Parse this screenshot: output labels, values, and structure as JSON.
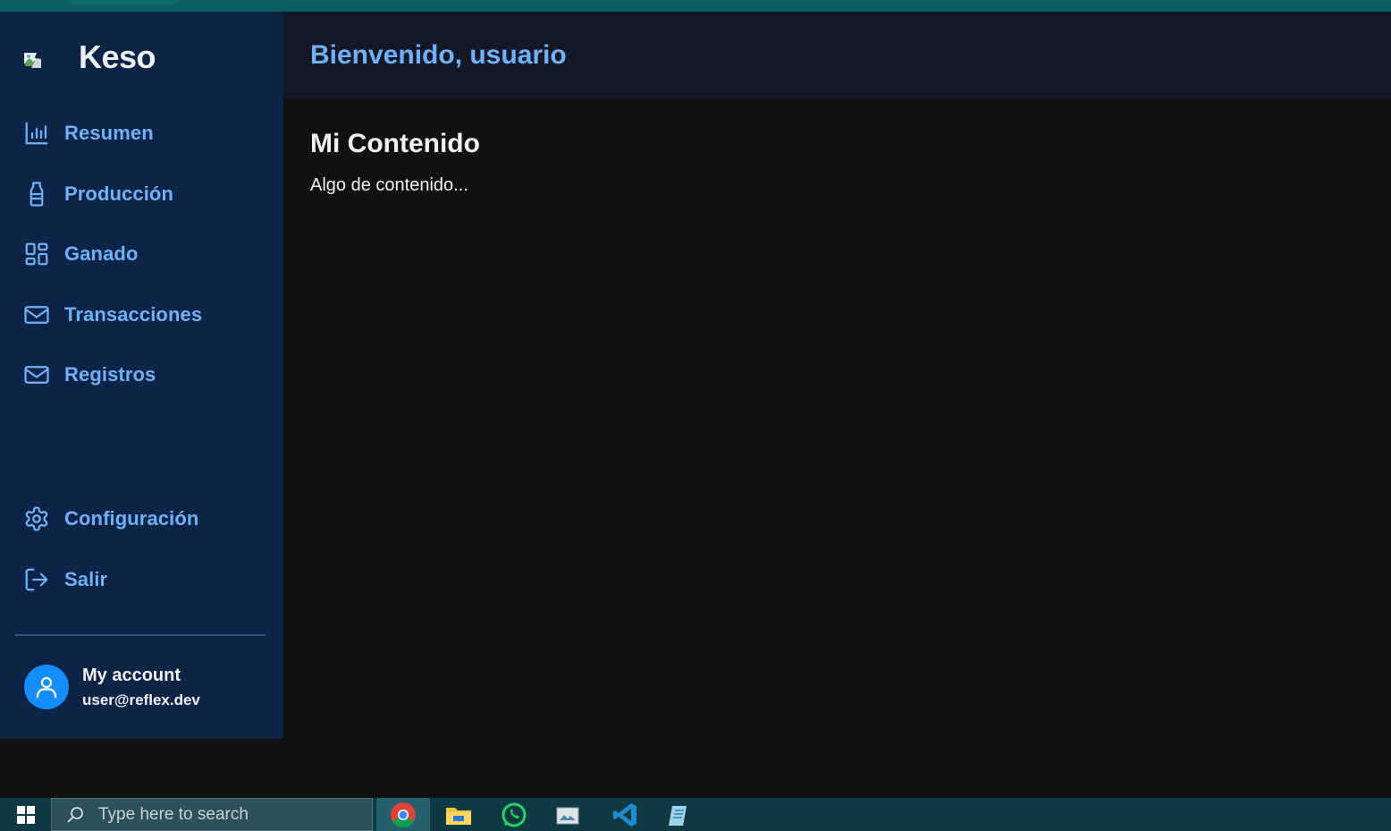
{
  "sidebar": {
    "brand": "Keso",
    "items": [
      {
        "label": "Resumen",
        "icon": "bar-chart-icon"
      },
      {
        "label": "Producción",
        "icon": "bottle-icon"
      },
      {
        "label": "Ganado",
        "icon": "layout-grid-icon"
      },
      {
        "label": "Transacciones",
        "icon": "mail-icon"
      },
      {
        "label": "Registros",
        "icon": "mail-icon"
      }
    ],
    "bottom_items": [
      {
        "label": "Configuración",
        "icon": "settings-icon"
      },
      {
        "label": "Salir",
        "icon": "log-out-icon"
      }
    ],
    "account": {
      "name": "My account",
      "email": "user@reflex.dev"
    }
  },
  "header": {
    "welcome": "Bienvenido, usuario"
  },
  "main": {
    "title": "Mi Contenido",
    "body": "Algo de contenido..."
  },
  "taskbar": {
    "search_placeholder": "Type here to search",
    "apps": [
      "chrome-icon",
      "file-explorer-icon",
      "whatsapp-icon",
      "photos-icon",
      "vscode-icon",
      "notepad-icon"
    ]
  },
  "colors": {
    "sidebar_bg": "#0d2447",
    "accent": "#6fb1f8",
    "avatar": "#148dff",
    "header_bg": "#121826",
    "content_bg": "#111113"
  }
}
